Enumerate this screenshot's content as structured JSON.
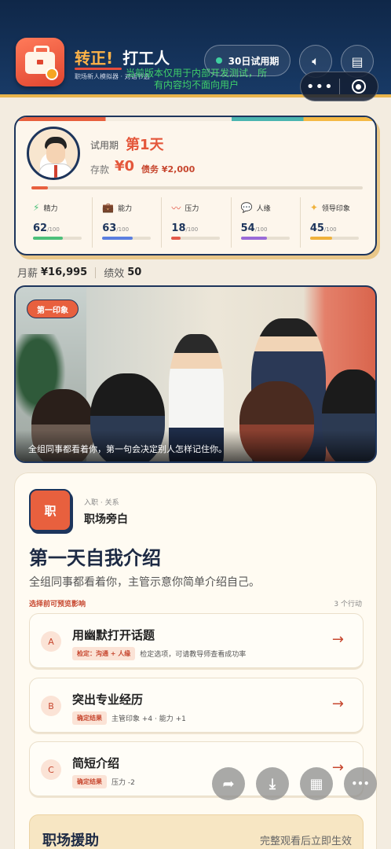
{
  "header": {
    "title_main": "转正!",
    "title_sub": "打工人",
    "subtitle": "职场新人模拟器 · 对话节选",
    "dev_notice": "当前版本仅用于内部开发测试，所有内容均不面向用户",
    "trial_pill": "30日试用期",
    "sound_icon": "speaker-icon",
    "log_icon": "document-icon",
    "capsule_more": "•••",
    "capsule_close": "target-icon"
  },
  "status": {
    "probation_label": "试用期",
    "day": "第1天",
    "cash_label": "存款",
    "cash": "¥0",
    "debt": "债务 ¥2,000",
    "day_progress": 0.05,
    "stats": [
      {
        "name": "精力",
        "icon": "⚡",
        "value": "62",
        "max": "/100",
        "pct": 62,
        "color": "#4cc07a"
      },
      {
        "name": "能力",
        "icon": "💼",
        "value": "63",
        "max": "/100",
        "pct": 63,
        "color": "#5b7fe0"
      },
      {
        "name": "压力",
        "icon": "〰",
        "value": "18",
        "max": "/100",
        "pct": 18,
        "color": "#e35a4a"
      },
      {
        "name": "人缘",
        "icon": "💬",
        "value": "54",
        "max": "/100",
        "pct": 54,
        "color": "#9a6ad8"
      },
      {
        "name": "领导印象",
        "icon": "✦",
        "value": "45",
        "max": "/100",
        "pct": 45,
        "color": "#f0b23c"
      }
    ]
  },
  "salary": {
    "salary_label": "月薪",
    "salary": "¥16,995",
    "perf_label": "绩效",
    "perf": "50"
  },
  "scene": {
    "tag": "第一印象",
    "caption": "全组同事都看着你，第一句会决定别人怎样记住你。"
  },
  "event": {
    "badge": "职",
    "kicker": "入职 · 关系",
    "source": "职场旁白",
    "title": "第一天自我介绍",
    "desc": "全组同事都看着你，主管示意你简单介绍自己。",
    "hint": "选择前可预览影响",
    "count": "3 个行动",
    "choices": [
      {
        "letter": "A",
        "text": "用幽默打开话题",
        "tag": "检定：沟通 + 人缘",
        "detail": "检定选项，可请教导师查看成功率"
      },
      {
        "letter": "B",
        "text": "突出专业经历",
        "tag": "确定结果",
        "detail": "主管印象 +4 · 能力 +1"
      },
      {
        "letter": "C",
        "text": "简短介绍",
        "tag": "确定结果",
        "detail": "压力 -2"
      }
    ],
    "help_title": "职场援助",
    "help_sub": "完整观看后立即生效"
  },
  "fabs": [
    {
      "name": "share-icon",
      "glyph": "➦"
    },
    {
      "name": "download-icon",
      "glyph": "⤓"
    },
    {
      "name": "grid-icon",
      "glyph": "▦"
    },
    {
      "name": "more-icon",
      "glyph": "•••"
    }
  ]
}
